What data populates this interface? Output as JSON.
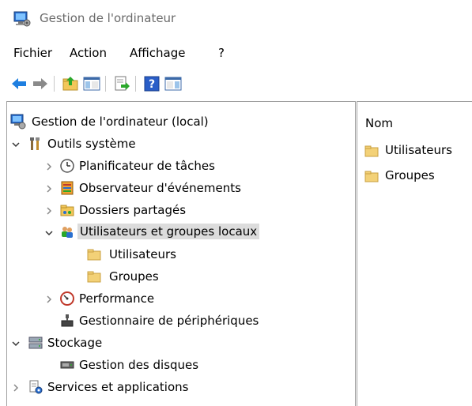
{
  "window": {
    "title": "Gestion de l'ordinateur"
  },
  "menu": {
    "items": [
      "Fichier",
      "Action",
      "Affichage",
      "?"
    ]
  },
  "toolbar": {
    "icons": [
      "back-arrow-icon",
      "forward-arrow-icon",
      "up-folder-icon",
      "show-hide-tree-icon",
      "export-list-icon",
      "help-icon",
      "action-pane-icon"
    ]
  },
  "tree": {
    "root": "Gestion de l'ordinateur (local)",
    "outils": "Outils système",
    "planificateur": "Planificateur de tâches",
    "observateur": "Observateur d'événements",
    "dossiers": "Dossiers partagés",
    "utilisateurs_groupes": "Utilisateurs et groupes locaux",
    "utilisateurs": "Utilisateurs",
    "groupes": "Groupes",
    "performance": "Performance",
    "gestionnaire": "Gestionnaire de périphériques",
    "stockage": "Stockage",
    "disques": "Gestion des disques",
    "services": "Services et applications"
  },
  "list": {
    "column_header": "Nom",
    "items": [
      "Utilisateurs",
      "Groupes"
    ]
  },
  "colors": {
    "selection": "#dcdcdc",
    "folder": "#f3d177",
    "accent_blue": "#1e90ff"
  }
}
